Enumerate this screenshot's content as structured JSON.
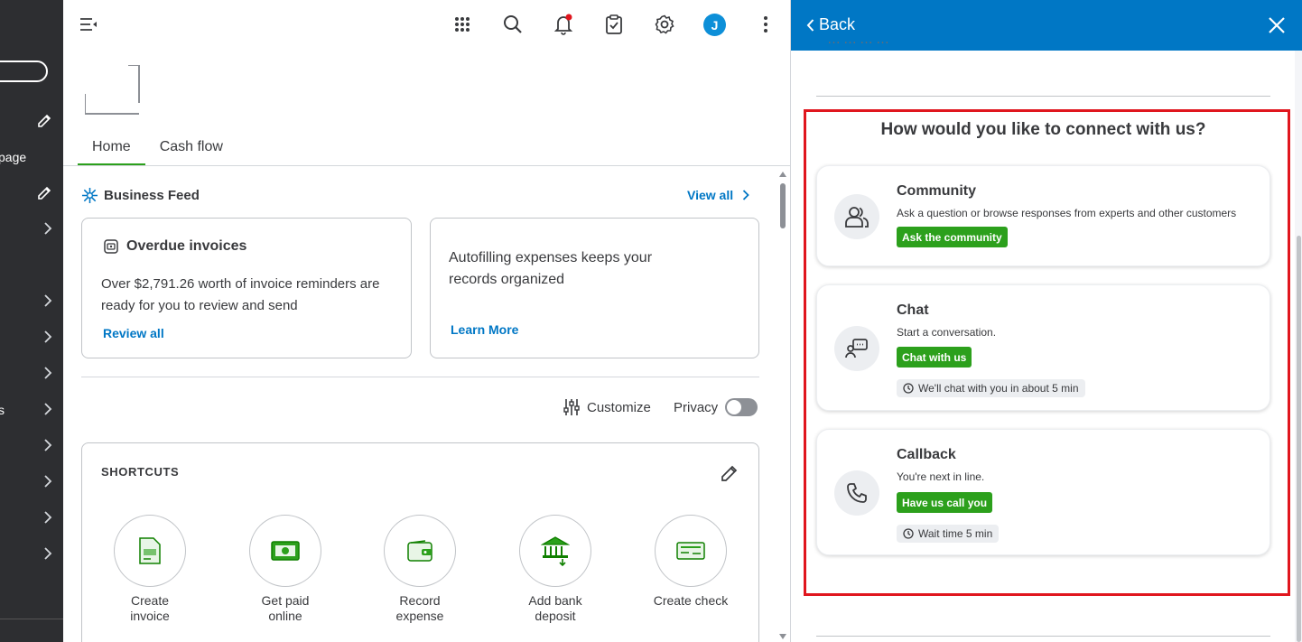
{
  "sidebar": {
    "texts": [
      "page",
      "s"
    ]
  },
  "topbar": {
    "avatar_initial": "J"
  },
  "tabs": [
    "Home",
    "Cash flow"
  ],
  "business_feed": {
    "title": "Business Feed",
    "view_all": "View all",
    "cards": [
      {
        "title": "Overdue invoices",
        "body": "Over $2,791.26 worth of invoice reminders are ready for you to review and send",
        "link": "Review all"
      },
      {
        "body": "Autofilling expenses keeps your records organized",
        "link": "Learn More"
      }
    ]
  },
  "controls": {
    "customize": "Customize",
    "privacy": "Privacy",
    "privacy_on": false
  },
  "shortcuts": {
    "title": "SHORTCUTS",
    "items": [
      {
        "label": "Create\ninvoice",
        "icon": "invoice-icon"
      },
      {
        "label": "Get paid\nonline",
        "icon": "cash-icon"
      },
      {
        "label": "Record\nexpense",
        "icon": "wallet-icon"
      },
      {
        "label": "Add bank\ndeposit",
        "icon": "bank-icon"
      },
      {
        "label": "Create check",
        "icon": "check-icon"
      }
    ]
  },
  "panel": {
    "back": "Back",
    "heading": "How would you like to connect with us?",
    "options": [
      {
        "title": "Community",
        "desc": "Ask a question or browse responses from experts and other customers",
        "button": "Ask the community",
        "icon": "community-icon"
      },
      {
        "title": "Chat",
        "desc": "Start a conversation.",
        "button": "Chat with us",
        "wait": "We'll chat with you in about 5 min",
        "icon": "chat-icon"
      },
      {
        "title": "Callback",
        "desc": "You're next in line.",
        "button": "Have us call you",
        "wait": "Wait time 5 min",
        "icon": "phone-icon"
      }
    ]
  },
  "colors": {
    "accent_blue": "#0077c5",
    "accent_green": "#2ca01c",
    "highlight_red": "#e0161e",
    "sidebar_bg": "#2d2e31"
  }
}
